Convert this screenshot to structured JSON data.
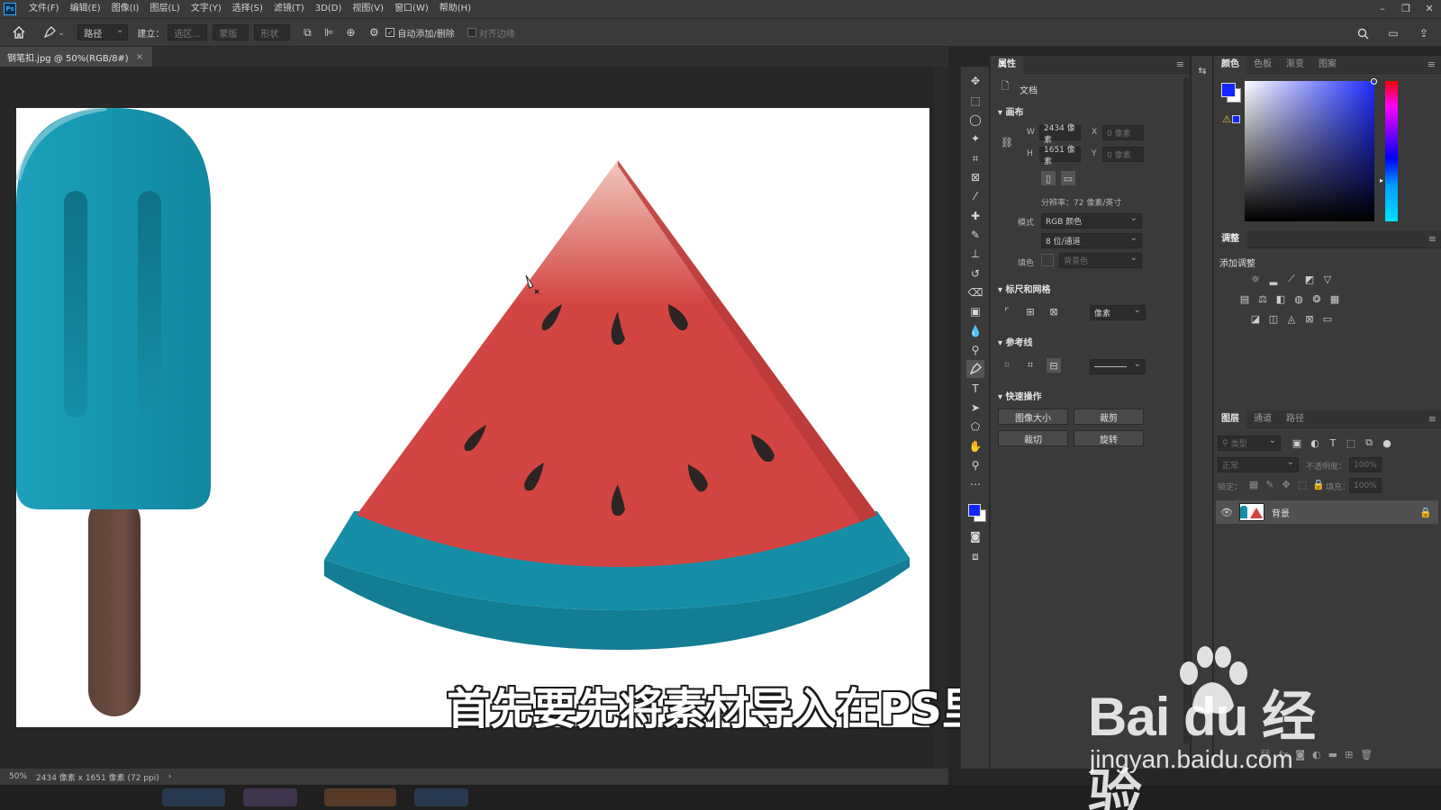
{
  "menubar": {
    "items": [
      "文件(F)",
      "编辑(E)",
      "图像(I)",
      "图层(L)",
      "文字(Y)",
      "选择(S)",
      "滤镜(T)",
      "3D(D)",
      "视图(V)",
      "窗口(W)",
      "帮助(H)"
    ]
  },
  "options": {
    "mode": "路径",
    "make_label": "建立：",
    "selection_btn": "选区...",
    "mask_btn": "蒙版",
    "shape_btn": "形状",
    "auto_add_label": "自动添加/删除",
    "align_edges_label": "对齐边缘"
  },
  "document": {
    "tab_title": "钢笔扣.jpg @ 50%(RGB/8#)",
    "subtitle": "首先要先将素材导入在PS里"
  },
  "status": {
    "zoom": "50%",
    "info": "2434 像素 x 1651 像素 (72 ppi)"
  },
  "properties": {
    "tab": "属性",
    "doc_label": "文档",
    "canvas_section": "画布",
    "w_label": "W",
    "w_value": "2434 像素",
    "x_label": "X",
    "x_placeholder": "0 像素",
    "h_label": "H",
    "h_value": "1651 像素",
    "y_label": "Y",
    "y_placeholder": "0 像素",
    "resolution": "分辨率：72 像素/英寸",
    "mode_label": "模式",
    "mode_value": "RGB 颜色",
    "depth_value": "8 位/通道",
    "fill_label": "填色",
    "fill_value": "背景色",
    "rulers_section": "标尺和网格",
    "units_value": "像素",
    "guides_section": "参考线",
    "quick_section": "快速操作",
    "quick_buttons": [
      "图像大小",
      "裁剪",
      "裁切",
      "旋转"
    ]
  },
  "color_panel": {
    "tabs": [
      "颜色",
      "色板",
      "渐变",
      "图案"
    ],
    "foreground": "#1226ff",
    "background": "#ffffff"
  },
  "adjustments": {
    "tab": "调整",
    "add_label": "添加调整"
  },
  "layers": {
    "tabs": [
      "图层",
      "通道",
      "路径"
    ],
    "filter_placeholder": "类型",
    "blend_mode": "正常",
    "opacity_label": "不透明度：",
    "opacity_value": "100%",
    "lock_label": "锁定：",
    "fill_label": "填充：",
    "fill_value": "100%",
    "layer_name": "背景"
  },
  "watermark": {
    "brand": "Bai du 经验",
    "url": "jingyan.baidu.com"
  },
  "colors": {
    "popsicle_blue": "#168fa8",
    "melon_red": "#d34542",
    "rind_blue": "#168ea7",
    "stick_brown": "#6b4a3f"
  }
}
